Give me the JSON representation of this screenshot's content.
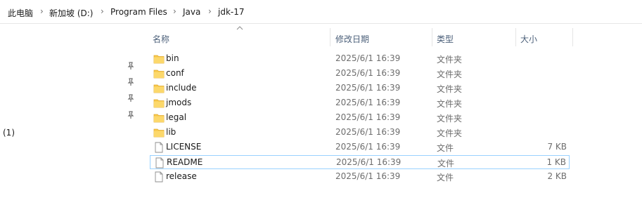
{
  "breadcrumb": {
    "items": [
      "此电脑",
      "新加坡 (D:)",
      "Program Files",
      "Java",
      "jdk-17"
    ]
  },
  "nav": {
    "drive_count": "(1)"
  },
  "columns": {
    "name": "名称",
    "date": "修改日期",
    "type": "类型",
    "size": "大小"
  },
  "files": [
    {
      "name": "bin",
      "date": "2025/6/1 16:39",
      "type": "文件夹",
      "size": "",
      "kind": "folder"
    },
    {
      "name": "conf",
      "date": "2025/6/1 16:39",
      "type": "文件夹",
      "size": "",
      "kind": "folder"
    },
    {
      "name": "include",
      "date": "2025/6/1 16:39",
      "type": "文件夹",
      "size": "",
      "kind": "folder"
    },
    {
      "name": "jmods",
      "date": "2025/6/1 16:39",
      "type": "文件夹",
      "size": "",
      "kind": "folder"
    },
    {
      "name": "legal",
      "date": "2025/6/1 16:39",
      "type": "文件夹",
      "size": "",
      "kind": "folder"
    },
    {
      "name": "lib",
      "date": "2025/6/1 16:39",
      "type": "文件夹",
      "size": "",
      "kind": "folder"
    },
    {
      "name": "LICENSE",
      "date": "2025/6/1 16:39",
      "type": "文件",
      "size": "7 KB",
      "kind": "file"
    },
    {
      "name": "README",
      "date": "2025/6/1 16:39",
      "type": "文件",
      "size": "1 KB",
      "kind": "file"
    },
    {
      "name": "release",
      "date": "2025/6/1 16:39",
      "type": "文件",
      "size": "2 KB",
      "kind": "file"
    }
  ],
  "selected_file": "README",
  "colors": {
    "folder": "#f8c94a",
    "selection_border": "#99d1ff",
    "header_text": "#4c607a"
  }
}
